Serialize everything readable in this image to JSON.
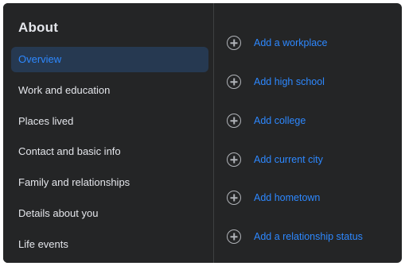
{
  "about": {
    "title": "About",
    "nav": [
      {
        "label": "Overview",
        "active": true
      },
      {
        "label": "Work and education",
        "active": false
      },
      {
        "label": "Places lived",
        "active": false
      },
      {
        "label": "Contact and basic info",
        "active": false
      },
      {
        "label": "Family and relationships",
        "active": false
      },
      {
        "label": "Details about you",
        "active": false
      },
      {
        "label": "Life events",
        "active": false
      }
    ],
    "overview_actions": [
      {
        "label": "Add a workplace",
        "icon": "plus-circle-icon"
      },
      {
        "label": "Add high school",
        "icon": "plus-circle-icon"
      },
      {
        "label": "Add college",
        "icon": "plus-circle-icon"
      },
      {
        "label": "Add current city",
        "icon": "plus-circle-icon"
      },
      {
        "label": "Add hometown",
        "icon": "plus-circle-icon"
      },
      {
        "label": "Add a relationship status",
        "icon": "plus-circle-icon"
      }
    ]
  },
  "colors": {
    "background": "#242526",
    "text": "#e4e6eb",
    "accent": "#2d88ff",
    "active_bg": "#263951",
    "icon": "#b0b3b8"
  }
}
